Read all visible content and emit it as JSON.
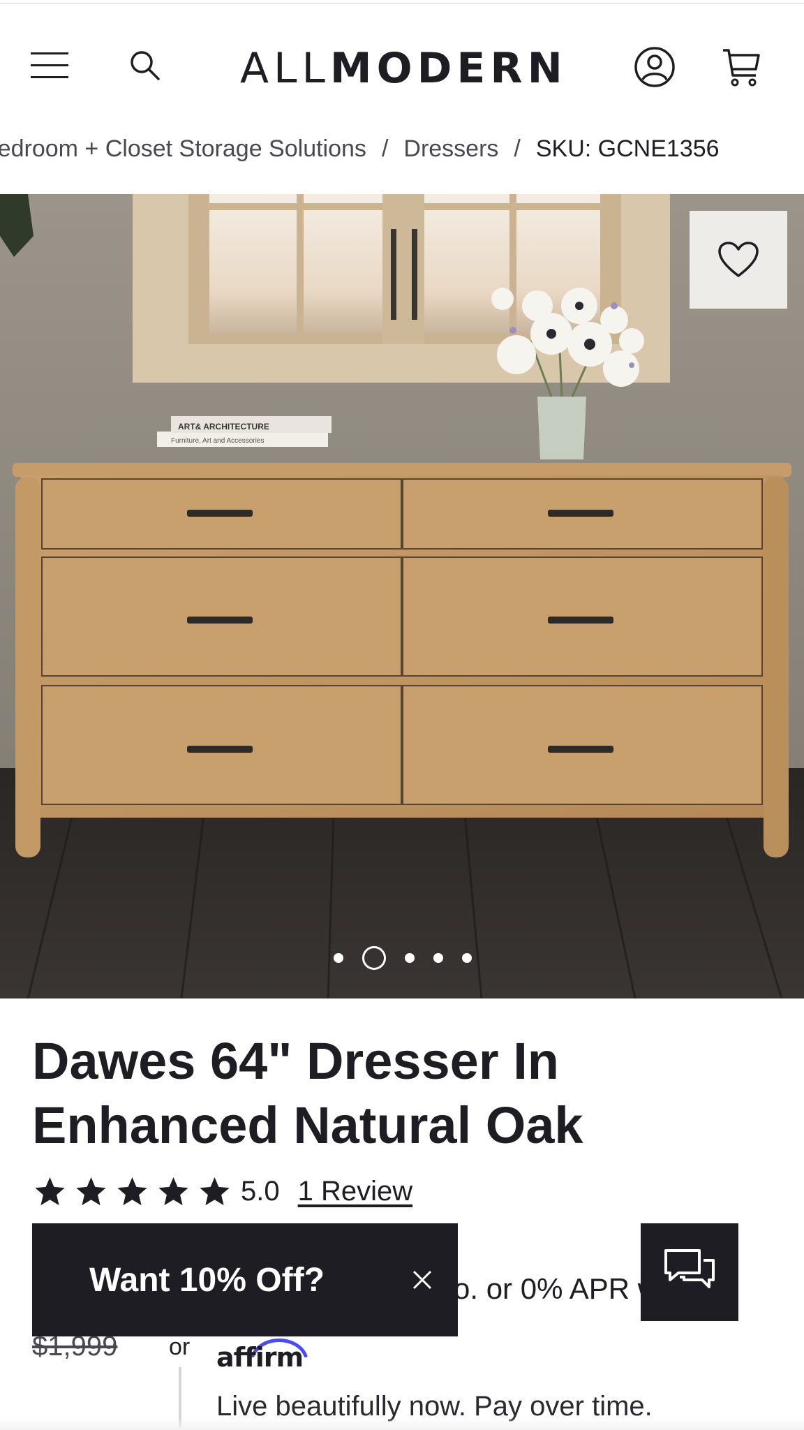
{
  "header": {
    "logo_light": "ALL",
    "logo_bold": "MODERN",
    "icons": {
      "menu": "hamburger-menu-icon",
      "search": "search-icon",
      "account": "account-icon",
      "cart": "cart-icon"
    }
  },
  "breadcrumb": {
    "items": [
      "Bedroom + Closet Storage Solutions",
      "Dressers"
    ],
    "separator": "/",
    "sku": "SKU: GCNE1356"
  },
  "gallery": {
    "image_count": 5,
    "active_index": 1,
    "favorite_icon": "heart-outline-icon",
    "book_top": "ART& ARCHITECTURE",
    "book_bottom": "Furniture, Art and Accessories"
  },
  "product": {
    "title": "Dawes 64\" Dresser In Enhanced Natural Oak",
    "rating_value": "5.0",
    "rating_stars": 5,
    "review_link": "1 Review"
  },
  "pricing": {
    "apr_text": "o. or 0% APR w",
    "old_price": "$1,999",
    "or_text": "or",
    "affirm_logo": "affirm",
    "affirm_tagline": "Live beautifully now. Pay over time."
  },
  "promo": {
    "label": "Want 10% Off?",
    "close_icon": "close-icon"
  },
  "chat": {
    "icon": "chat-bubbles-icon"
  },
  "colors": {
    "brand_dark": "#1f1d24",
    "affirm_blue": "#4a4af4",
    "oak": "#c49a67"
  }
}
